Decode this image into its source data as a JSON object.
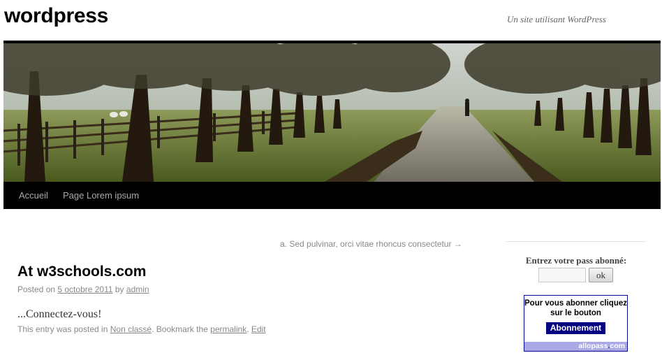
{
  "site": {
    "title": "wordpress",
    "description": "Un site utilisant WordPress"
  },
  "menu": {
    "items": [
      {
        "label": "Accueil"
      },
      {
        "label": "Page Lorem ipsum"
      }
    ]
  },
  "nav_above": {
    "label": "a. Sed pulvinar, orci vitae rhoncus consectetur →"
  },
  "post": {
    "title": "At w3schools.com",
    "meta": {
      "posted_on": "Posted on ",
      "date": "5 octobre 2011",
      "by": " by ",
      "author": "admin"
    },
    "content": "...Connectez-vous!",
    "utility": {
      "prefix": "This entry was posted in ",
      "category": "Non classé",
      "middle": ". Bookmark the ",
      "permalink": "permalink",
      "sep": ". ",
      "edit": "Edit"
    }
  },
  "sidebar": {
    "widget_title": "Entrez votre pass abonné:",
    "pass_input": {
      "value": "",
      "placeholder": ""
    },
    "ok_label": "ok",
    "allopass": {
      "text": "Pour vous abonner cliquez sur le bouton",
      "button_label": "Abonnement",
      "brand_main": "allopass",
      "brand_dot": ".",
      "brand_tld": "com"
    }
  },
  "colors": {
    "menu_bar": "#000000",
    "allopass_button": "#000080",
    "allopass_footer": "#a9a9e6"
  }
}
